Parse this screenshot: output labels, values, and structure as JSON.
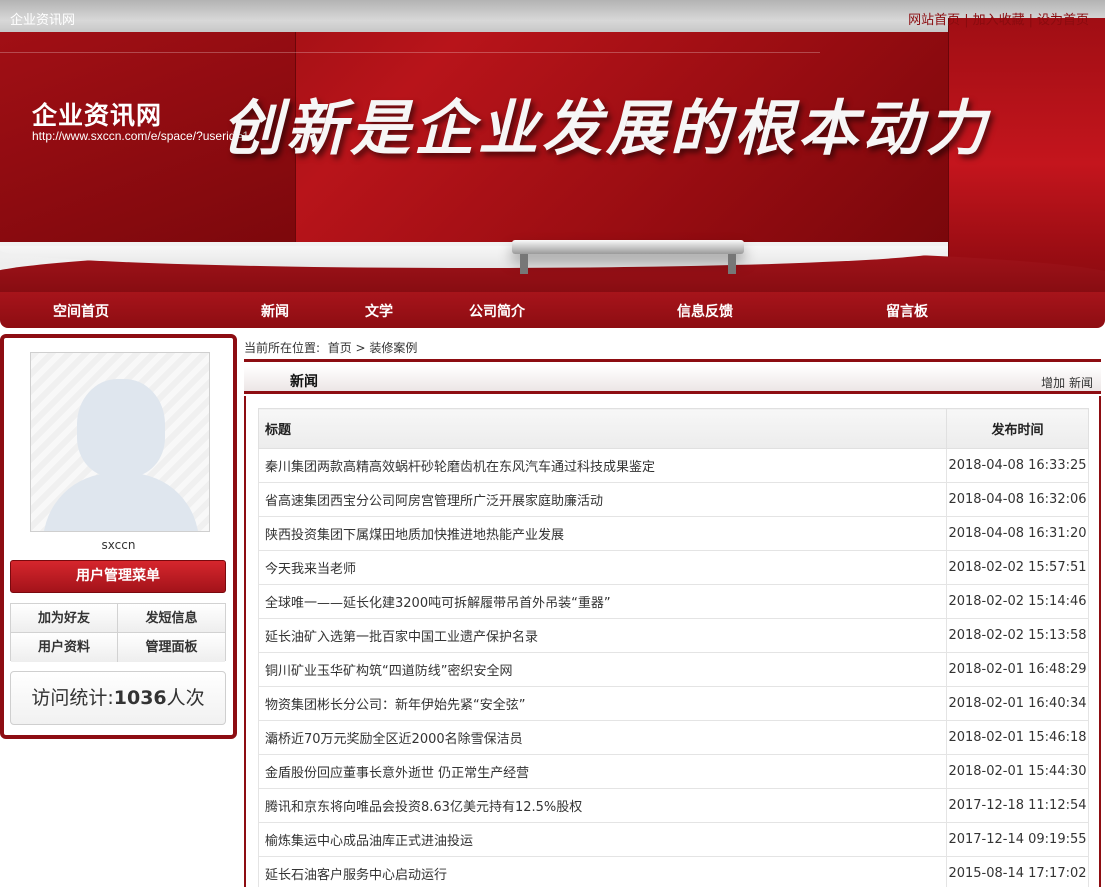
{
  "header": {
    "site_title": "企业资讯网",
    "top_links": [
      "网站首页",
      "加入收藏",
      "设为首页"
    ],
    "brand_name": "企业资讯网",
    "brand_url": "http://www.sxccn.com/e/space/?userid=1",
    "slogan": "创新是企业发展的根本动力"
  },
  "nav": {
    "items": [
      "空间首页",
      "新闻",
      "文学",
      "公司简介",
      "信息反馈",
      "留言板"
    ]
  },
  "sidebar": {
    "username": "sxccn",
    "menu_title": "用户管理菜单",
    "menu_items": [
      "加为好友",
      "发短信息",
      "用户资料",
      "管理面板"
    ],
    "visit_label": "访问统计:",
    "visit_count": "1036",
    "visit_unit": "人次"
  },
  "main": {
    "breadcrumb_prefix": "当前所在位置:",
    "breadcrumb_home": "首页",
    "breadcrumb_sep": ">",
    "breadcrumb_current": "装修案例",
    "tab_label": "新闻",
    "add_link": "增加 新闻",
    "table": {
      "col_title": "标题",
      "col_time": "发布时间",
      "rows": [
        {
          "title": "秦川集团两款高精高效蜗杆砂轮磨齿机在东风汽车通过科技成果鉴定",
          "time": "2018-04-08 16:33:25"
        },
        {
          "title": "省高速集团西宝分公司阿房宫管理所广泛开展家庭助廉活动",
          "time": "2018-04-08 16:32:06"
        },
        {
          "title": "陕西投资集团下属煤田地质加快推进地热能产业发展",
          "time": "2018-04-08 16:31:20"
        },
        {
          "title": "今天我来当老师",
          "time": "2018-02-02 15:57:51"
        },
        {
          "title": "全球唯一——延长化建3200吨可拆解履带吊首外吊装“重器”",
          "time": "2018-02-02 15:14:46"
        },
        {
          "title": "延长油矿入选第一批百家中国工业遗产保护名录",
          "time": "2018-02-02 15:13:58"
        },
        {
          "title": "铜川矿业玉华矿构筑“四道防线”密织安全网",
          "time": "2018-02-01 16:48:29"
        },
        {
          "title": "物资集团彬长分公司：新年伊始先紧“安全弦”",
          "time": "2018-02-01 16:40:34"
        },
        {
          "title": "灞桥近70万元奖励全区近2000名除雪保洁员",
          "time": "2018-02-01 15:46:18"
        },
        {
          "title": "金盾股份回应董事长意外逝世 仍正常生产经营",
          "time": "2018-02-01 15:44:30"
        },
        {
          "title": "腾讯和京东将向唯品会投资8.63亿美元持有12.5%股权",
          "time": "2017-12-18 11:12:54"
        },
        {
          "title": "榆炼集运中心成品油库正式进油投运",
          "time": "2017-12-14 09:19:55"
        },
        {
          "title": "延长石油客户服务中心启动运行",
          "time": "2015-08-14 17:17:02"
        }
      ]
    }
  }
}
